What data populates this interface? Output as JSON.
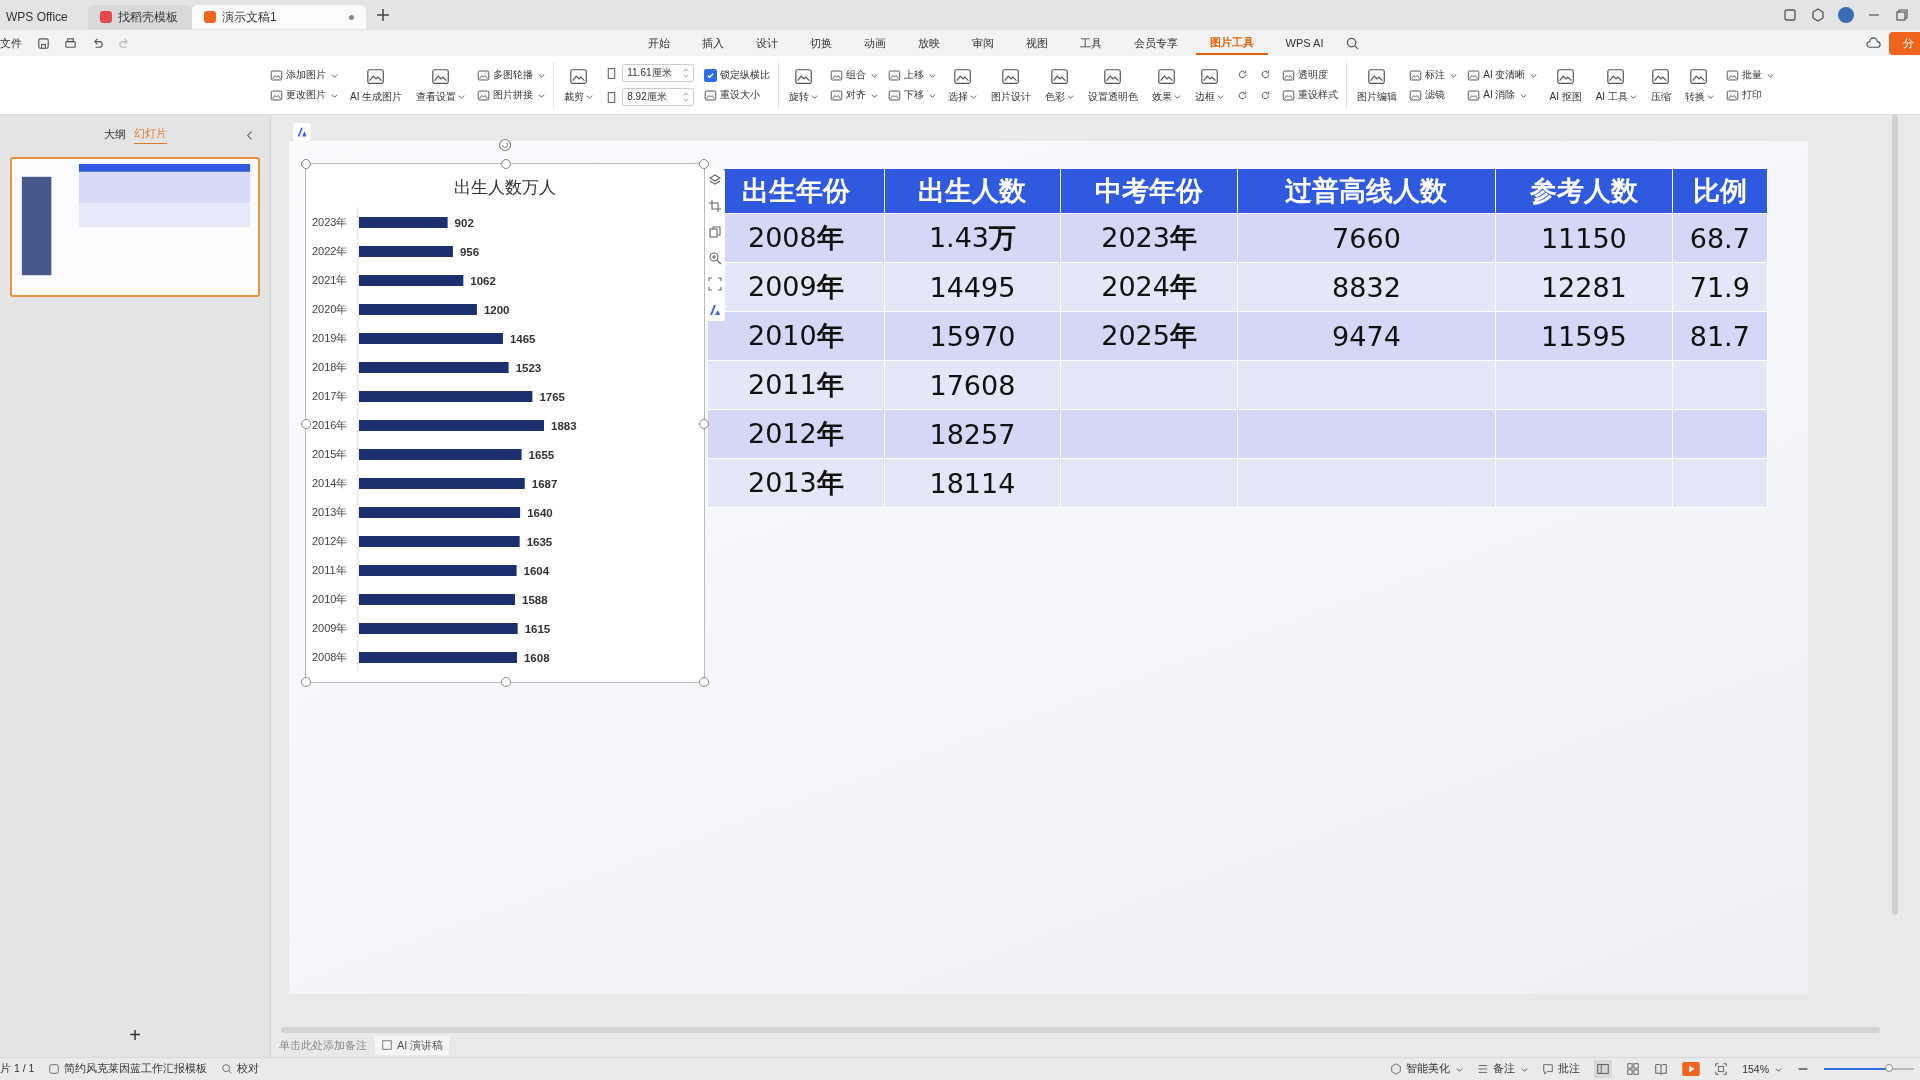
{
  "title_tabs": [
    {
      "label": "WPS Office",
      "kind": "home",
      "selected": false
    },
    {
      "label": "找稻壳模板",
      "kind": "template",
      "selected": false
    },
    {
      "label": "演示文稿1",
      "kind": "doc",
      "selected": true
    }
  ],
  "menu": {
    "file": "文件",
    "tabs": [
      {
        "label": "开始",
        "selected": false
      },
      {
        "label": "插入",
        "selected": false
      },
      {
        "label": "设计",
        "selected": false
      },
      {
        "label": "切换",
        "selected": false
      },
      {
        "label": "动画",
        "selected": false
      },
      {
        "label": "放映",
        "selected": false
      },
      {
        "label": "审阅",
        "selected": false
      },
      {
        "label": "视图",
        "selected": false
      },
      {
        "label": "工具",
        "selected": false
      },
      {
        "label": "会员专享",
        "selected": false
      },
      {
        "label": "图片工具",
        "selected": true
      },
      {
        "label": "WPS AI",
        "selected": false
      }
    ],
    "share": "分"
  },
  "ribbon": [
    [
      {
        "kind": "stack",
        "items": [
          {
            "kind": "button",
            "label": "添加图片",
            "caret": true
          },
          {
            "kind": "button",
            "label": "更改图片",
            "caret": true
          }
        ]
      },
      {
        "kind": "big",
        "label": "AI 生成图片",
        "caret": false
      },
      {
        "kind": "big",
        "label": "查看设置",
        "caret": true
      },
      {
        "kind": "stack",
        "items": [
          {
            "kind": "button",
            "label": "多图轮播",
            "caret": true
          },
          {
            "kind": "button",
            "label": "图片拼接",
            "caret": true
          }
        ]
      }
    ],
    [
      {
        "kind": "big",
        "label": "裁剪",
        "caret": true
      },
      {
        "kind": "stack",
        "items": [
          {
            "kind": "input",
            "label": "11.61厘米"
          },
          {
            "kind": "input",
            "label": "8.92厘米"
          }
        ]
      },
      {
        "kind": "stack",
        "items": [
          {
            "kind": "checkbox",
            "label": "锁定纵横比",
            "checked": true
          },
          {
            "kind": "button",
            "label": "重设大小",
            "caret": false
          }
        ]
      }
    ],
    [
      {
        "kind": "big",
        "label": "旋转",
        "caret": true
      },
      {
        "kind": "stack",
        "items": [
          {
            "kind": "button",
            "label": "组合",
            "caret": true
          },
          {
            "kind": "button",
            "label": "对齐",
            "caret": true
          }
        ]
      },
      {
        "kind": "stack",
        "items": [
          {
            "kind": "button",
            "label": "上移",
            "caret": true
          },
          {
            "kind": "button",
            "label": "下移",
            "caret": true
          }
        ]
      },
      {
        "kind": "big",
        "label": "选择",
        "caret": true
      },
      {
        "kind": "big",
        "label": "图片设计",
        "caret": false
      },
      {
        "kind": "big",
        "label": "色彩",
        "caret": true
      },
      {
        "kind": "big",
        "label": "设置透明色",
        "caret": false
      },
      {
        "kind": "big",
        "label": "效果",
        "caret": true
      },
      {
        "kind": "big",
        "label": "边框",
        "caret": true
      },
      {
        "kind": "stack",
        "items": [
          {
            "kind": "icon"
          },
          {
            "kind": "icon"
          }
        ]
      },
      {
        "kind": "stack",
        "items": [
          {
            "kind": "icon"
          },
          {
            "kind": "icon"
          }
        ]
      },
      {
        "kind": "stack",
        "items": [
          {
            "kind": "button",
            "label": "透明度",
            "caret": false
          },
          {
            "kind": "button",
            "label": "重设样式",
            "caret": false
          }
        ]
      }
    ],
    [
      {
        "kind": "big",
        "label": "图片编辑",
        "caret": false
      },
      {
        "kind": "stack",
        "items": [
          {
            "kind": "button",
            "label": "标注",
            "caret": true
          },
          {
            "kind": "button",
            "label": "滤镜",
            "caret": false
          }
        ]
      },
      {
        "kind": "stack",
        "items": [
          {
            "kind": "button",
            "label": "AI 变清晰",
            "caret": true
          },
          {
            "kind": "button",
            "label": "AI 消除",
            "caret": true
          }
        ]
      },
      {
        "kind": "big",
        "label": "AI 抠图",
        "caret": false
      },
      {
        "kind": "big",
        "label": "AI 工具",
        "caret": true
      },
      {
        "kind": "big",
        "label": "压缩",
        "caret": false
      },
      {
        "kind": "big",
        "label": "转换",
        "caret": true
      },
      {
        "kind": "stack",
        "items": [
          {
            "kind": "button",
            "label": "批量",
            "caret": true
          },
          {
            "kind": "button",
            "label": "打印",
            "caret": false
          }
        ]
      }
    ]
  ],
  "side_panel": {
    "tabs": [
      {
        "label": "大纲",
        "selected": false
      },
      {
        "label": "幻灯片",
        "selected": true
      }
    ],
    "slides": [
      {
        "selected": true
      }
    ],
    "add": "+"
  },
  "chart": {
    "chart_data": {
      "type": "bar",
      "orientation": "horizontal",
      "title": "出生人数万人",
      "categories": [
        "2023年",
        "2022年",
        "2021年",
        "2020年",
        "2019年",
        "2018年",
        "2017年",
        "2016年",
        "2015年",
        "2014年",
        "2013年",
        "2012年",
        "2011年",
        "2010年",
        "2009年",
        "2008年"
      ],
      "series": [
        {
          "color": "#1c2f6e",
          "values": [
            902,
            956,
            1062,
            1200,
            1465,
            1523,
            1765,
            1883,
            1655,
            1687,
            1640,
            1635,
            1604,
            1588,
            1615,
            1608
          ]
        }
      ],
      "data_labels": true
    }
  },
  "table": {
    "columns": [
      "出生年份",
      "出生人数",
      "中考年份",
      "过普高线人数",
      "参考人数",
      "比例"
    ],
    "rows": [
      [
        "2008**年**",
        "1.43**万**",
        "2023**年**",
        "7660",
        "11150",
        "68.7"
      ],
      [
        "2009**年**",
        "14495",
        "2024**年**",
        "8832",
        "12281",
        "71.9"
      ],
      [
        "2010**年**",
        "15970",
        "2025**年**",
        "9474",
        "11595",
        "81.7"
      ],
      [
        "2011**年**",
        "17608",
        "",
        "",
        "",
        ""
      ],
      [
        "2012**年**",
        "18257",
        "",
        "",
        "",
        ""
      ],
      [
        "2013**年**",
        "18114",
        "",
        "",
        "",
        ""
      ]
    ]
  },
  "notes": {
    "placeholder": "单击此处添加备注",
    "ai_button": "AI 演讲稿"
  },
  "status_bar": {
    "slide": "片 1 / 1",
    "template": "简约风克莱因蓝工作汇报模板",
    "proof": "校对",
    "beautify": "智能美化",
    "notes": "备注",
    "comments": "批注",
    "zoom": "154%",
    "zoom_slider": {
      "level": 0.72
    }
  }
}
